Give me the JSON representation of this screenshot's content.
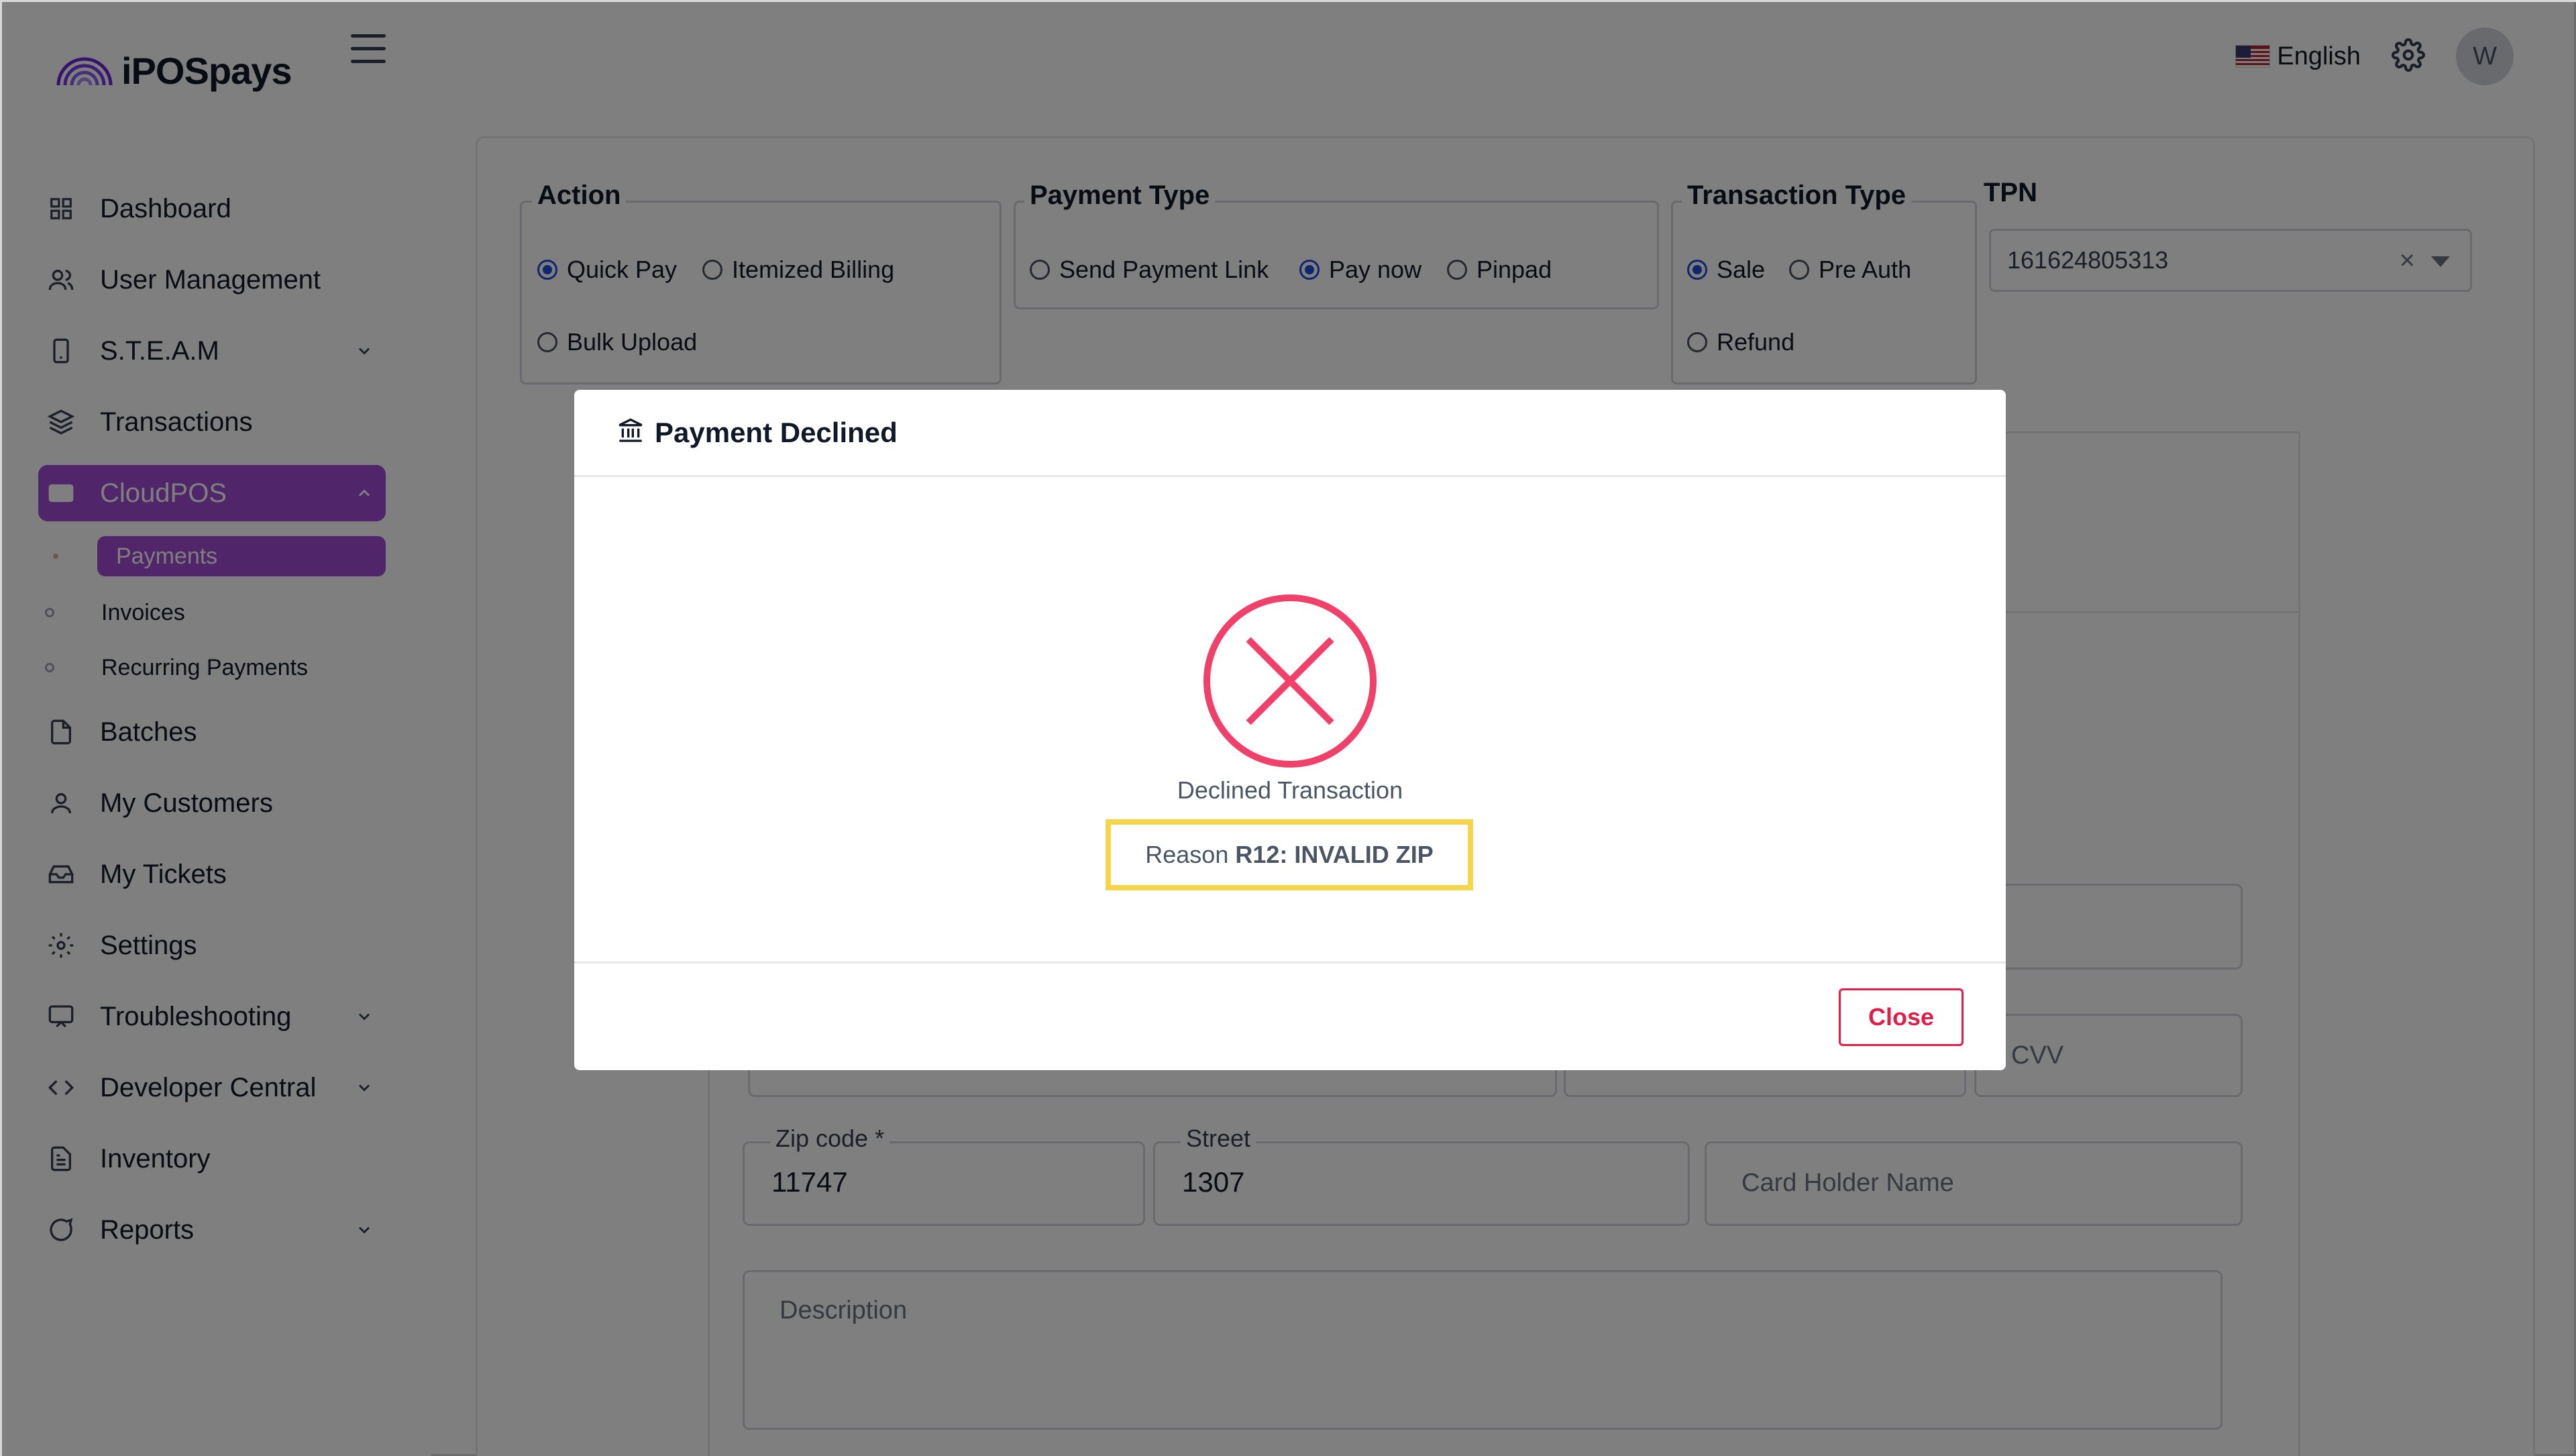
{
  "app": {
    "logo_text": "iPOSpays"
  },
  "topbar": {
    "language": "English",
    "avatar_initial": "W"
  },
  "sidebar": {
    "items": [
      {
        "label": "Dashboard",
        "icon": "grid-icon"
      },
      {
        "label": "User Management",
        "icon": "users-icon"
      },
      {
        "label": "S.T.E.A.M",
        "icon": "phone-icon",
        "expandable": true
      },
      {
        "label": "Transactions",
        "icon": "layers-icon"
      },
      {
        "label": "CloudPOS",
        "icon": "card-icon",
        "expandable": true,
        "active": true
      },
      {
        "label": "Batches",
        "icon": "file-icon"
      },
      {
        "label": "My Customers",
        "icon": "user-icon"
      },
      {
        "label": "My Tickets",
        "icon": "inbox-icon"
      },
      {
        "label": "Settings",
        "icon": "gear-icon"
      },
      {
        "label": "Troubleshooting",
        "icon": "monitor-icon",
        "expandable": true
      },
      {
        "label": "Developer Central",
        "icon": "code-icon",
        "expandable": true
      },
      {
        "label": "Inventory",
        "icon": "document-icon"
      },
      {
        "label": "Reports",
        "icon": "chat-icon",
        "expandable": true
      }
    ],
    "subitems": [
      {
        "label": "Payments",
        "active": true
      },
      {
        "label": "Invoices"
      },
      {
        "label": "Recurring Payments"
      }
    ]
  },
  "form": {
    "action": {
      "legend": "Action",
      "options": [
        "Quick Pay",
        "Itemized Billing",
        "Bulk Upload"
      ],
      "selected": "Quick Pay"
    },
    "payment_type": {
      "legend": "Payment Type",
      "options": [
        "Send Payment Link",
        "Pay now",
        "Pinpad"
      ],
      "selected": "Pay now"
    },
    "transaction_type": {
      "legend": "Transaction Type",
      "options": [
        "Sale",
        "Pre Auth",
        "Refund"
      ],
      "selected": "Sale"
    },
    "tpn": {
      "label": "TPN",
      "value": "161624805313",
      "clear": "×"
    },
    "cvv_placeholder": "CVV",
    "zip": {
      "label": "Zip code *",
      "value": "11747"
    },
    "street": {
      "label": "Street",
      "value": "1307"
    },
    "card_holder_placeholder": "Card Holder Name",
    "description_placeholder": "Description"
  },
  "modal": {
    "title": "Payment Declined",
    "status_text": "Declined Transaction",
    "reason_label": "Reason",
    "reason_code": "R12: INVALID ZIP",
    "close_label": "Close"
  },
  "colors": {
    "accent": "#a24bd4",
    "danger": "#e11d48",
    "highlight": "#f7d54a",
    "radio": "#1d4ed8"
  }
}
